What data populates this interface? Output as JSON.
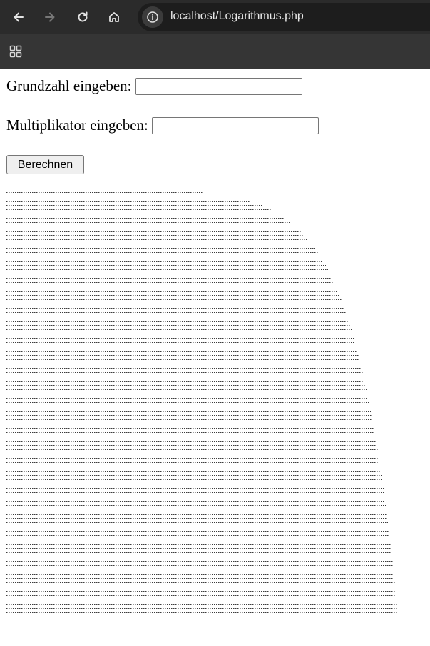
{
  "browser": {
    "url": "localhost/Logarithmus.php",
    "icons": {
      "back": "arrow-left-icon",
      "forward": "arrow-right-icon",
      "reload": "reload-icon",
      "home": "home-icon",
      "site_info": "info-icon",
      "apps": "apps-grid-icon"
    },
    "colors": {
      "toolbar": "#2b2b2b",
      "bookmark_bar": "#353535",
      "address_bar": "#1d1d1d"
    }
  },
  "form": {
    "base_label": "Grundzahl eingeben:",
    "base_value": "",
    "multiplier_label": "Multiplikator eingeben:",
    "multiplier_value": "",
    "submit_label": "Berechnen"
  },
  "output": {
    "description": "dense lines of repeated small characters; line lengths grow like a logarithmic curve",
    "line_count": 100
  }
}
